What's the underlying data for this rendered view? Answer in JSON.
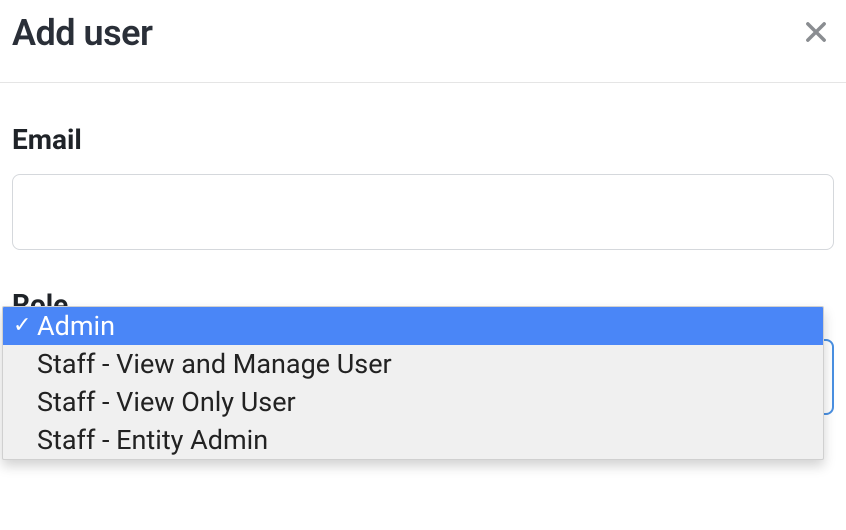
{
  "modal": {
    "title": "Add user"
  },
  "form": {
    "email": {
      "label": "Email",
      "value": ""
    },
    "role": {
      "label": "Role",
      "options": [
        {
          "label": "Admin"
        },
        {
          "label": "Staff - View and Manage User"
        },
        {
          "label": "Staff - View Only User"
        },
        {
          "label": "Staff - Entity Admin"
        }
      ]
    }
  }
}
